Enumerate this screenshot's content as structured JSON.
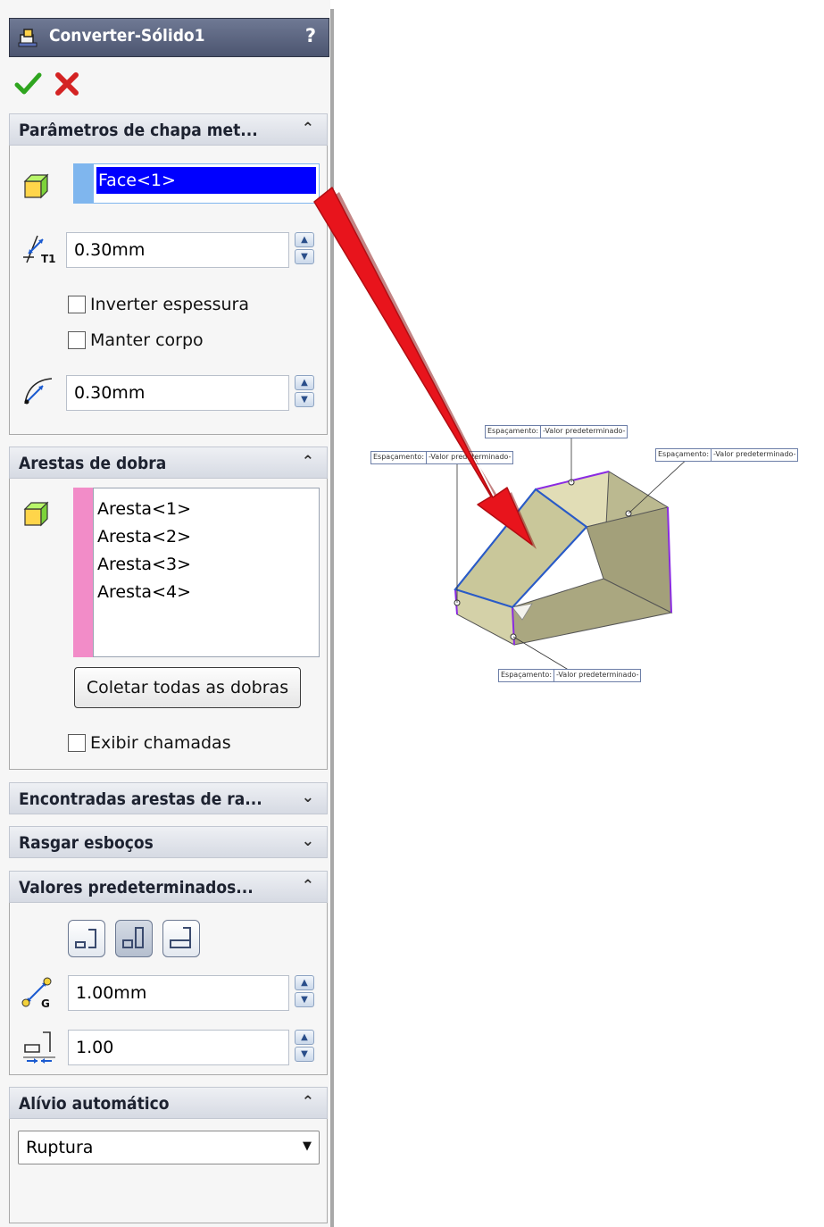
{
  "title": "Converter-Sólido1",
  "help": "?",
  "actions": {
    "ok_icon": "check-icon",
    "cancel_icon": "x-icon"
  },
  "sections": {
    "params": {
      "title": "Parâmetros de chapa met...",
      "face": "Face<1>",
      "thickness": "0.30mm",
      "reverse_thickness": "Inverter espessura",
      "keep_body": "Manter corpo",
      "radius": "0.30mm"
    },
    "bend_edges": {
      "title": "Arestas de dobra",
      "items": [
        "Aresta<1>",
        "Aresta<2>",
        "Aresta<3>",
        "Aresta<4>"
      ],
      "collect_button": "Coletar todas as dobras",
      "show_callouts": "Exibir chamadas"
    },
    "rip_edges": {
      "title": "Encontradas arestas de ra..."
    },
    "rip_sketches": {
      "title": "Rasgar esboços"
    },
    "defaults": {
      "title": "Valores predeterminados...",
      "gap": "1.00mm",
      "ratio": "1.00"
    },
    "auto_relief": {
      "title": "Alívio automático",
      "type": "Ruptura"
    }
  },
  "callouts": [
    {
      "label": "Espaçamento:",
      "value": "-Valor predeterminado-"
    },
    {
      "label": "Espaçamento:",
      "value": "-Valor predeterminado-"
    },
    {
      "label": "Espaçamento:",
      "value": "-Valor predeterminado-"
    },
    {
      "label": "Espaçamento:",
      "value": "-Valor predeterminado-"
    }
  ],
  "colors": {
    "accent": "#0000ff",
    "bend_list_bar": "#f28cc8",
    "arrow": "#e8141c",
    "model_face": "#c9c79a"
  }
}
